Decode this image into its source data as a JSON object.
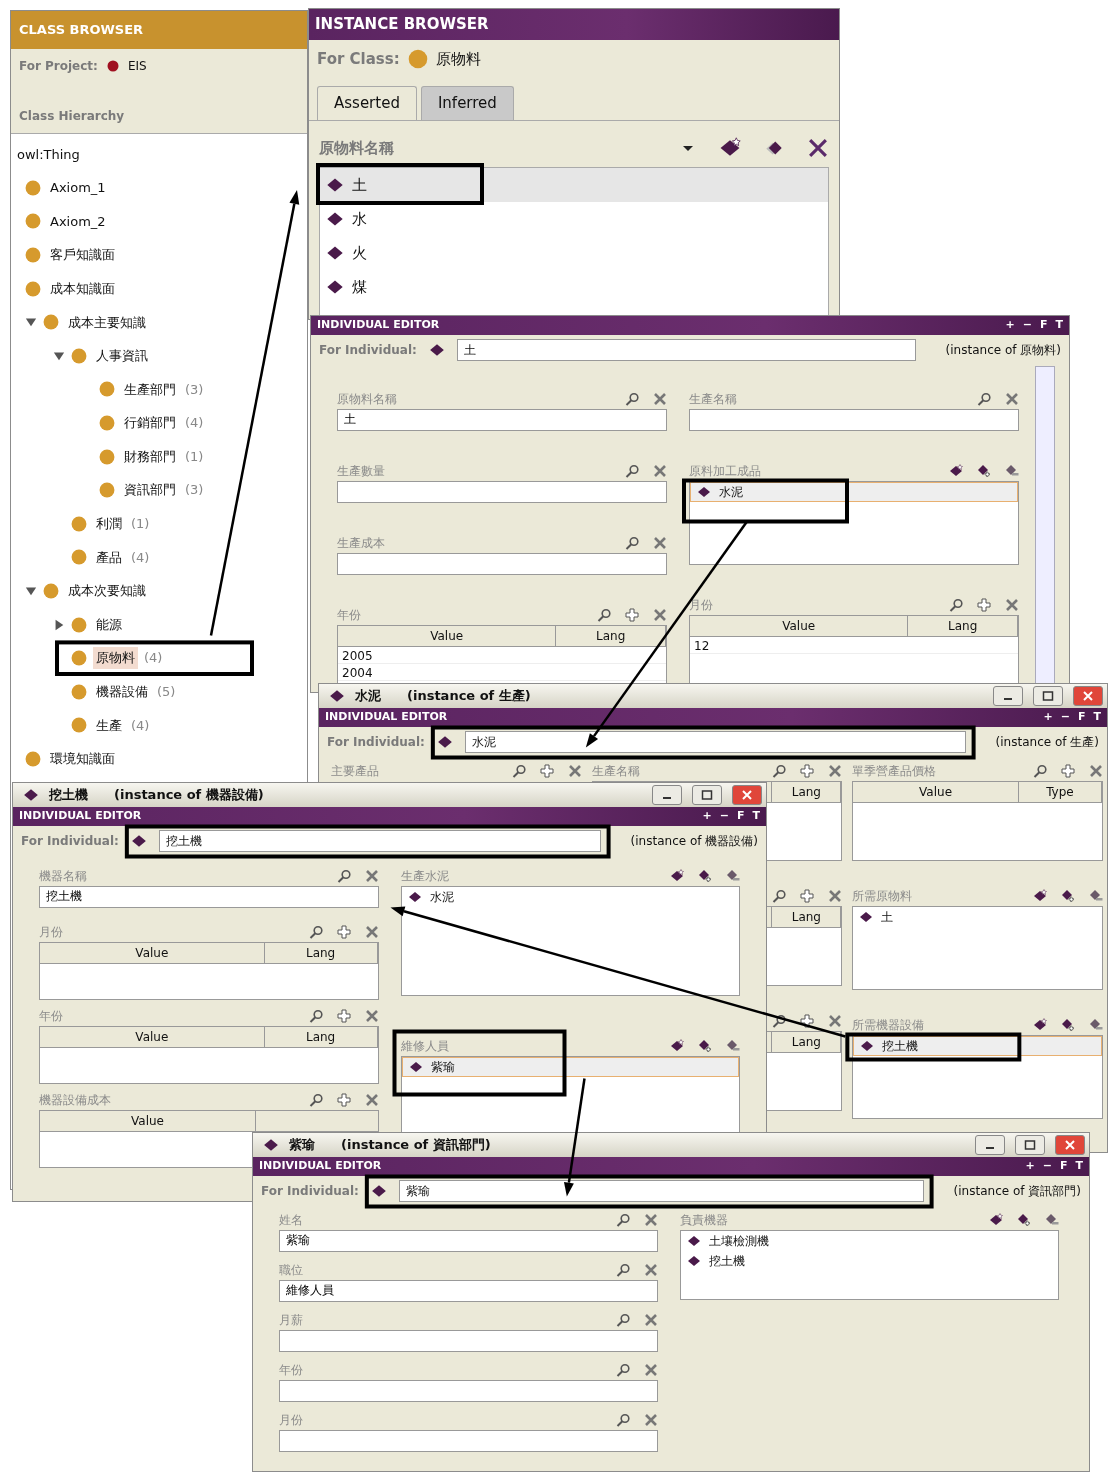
{
  "class_browser": {
    "title": "CLASS BROWSER",
    "project_label": "For Project:",
    "project": "EIS",
    "hierarchy_label": "Class Hierarchy",
    "root": "owl:Thing",
    "classes": [
      {
        "name": "Axiom_1",
        "selected": false
      },
      {
        "name": "Axiom_2",
        "selected": false
      },
      {
        "name": "客戶知識面",
        "selected": false
      },
      {
        "name": "成本知識面",
        "selected": false
      },
      {
        "name": "成本主要知識",
        "selected": false,
        "expanded": true,
        "children": [
          {
            "name": "人事資訊",
            "selected": false,
            "expanded": true,
            "children": [
              {
                "name": "生產部門",
                "count": "(3)",
                "selected": false
              },
              {
                "name": "行銷部門",
                "count": "(4)",
                "selected": false
              },
              {
                "name": "財務部門",
                "count": "(1)",
                "selected": false
              },
              {
                "name": "資訊部門",
                "count": "(3)",
                "selected": false
              }
            ]
          },
          {
            "name": "利潤",
            "count": "(1)",
            "selected": false
          },
          {
            "name": "產品",
            "count": "(4)",
            "selected": false
          }
        ]
      },
      {
        "name": "成本次要知識",
        "selected": false,
        "expanded": true,
        "children": [
          {
            "name": "能源",
            "selected": false,
            "expanded": false
          },
          {
            "name": "原物料",
            "count": "(4)",
            "selected": true
          },
          {
            "name": "機器設備",
            "count": "(5)",
            "selected": false
          },
          {
            "name": "生產",
            "count": "(4)",
            "selected": false
          }
        ]
      },
      {
        "name": "環境知識面",
        "selected": false
      }
    ]
  },
  "instance_browser": {
    "title": "INSTANCE BROWSER",
    "class_label": "For Class:",
    "class_name": "原物料",
    "tabs": [
      {
        "label": "Asserted",
        "selected": true
      },
      {
        "label": "Inferred",
        "selected": false
      }
    ],
    "list_header": "原物料名稱",
    "instances": [
      {
        "name": "土",
        "selected": true
      },
      {
        "name": "水",
        "selected": false
      },
      {
        "name": "火",
        "selected": false
      },
      {
        "name": "煤",
        "selected": false
      }
    ]
  },
  "editors": [
    {
      "title": "INDIVIDUAL EDITOR",
      "bar_buttons": [
        "+",
        "−",
        "F",
        "T"
      ],
      "for_label": "For Individual:",
      "individual": "土",
      "instance_of": "(instance of 原物料)",
      "columns": [
        [
          {
            "kind": "text",
            "label": "原物料名稱",
            "value": "土"
          },
          {
            "kind": "text",
            "label": "生產數量"
          },
          {
            "kind": "text",
            "label": "生產成本"
          },
          {
            "kind": "table",
            "label": "年份",
            "headers": [
              "Value",
              "Lang"
            ],
            "rows": [
              {
                "value": "2005"
              },
              {
                "value": "2004"
              }
            ]
          }
        ],
        [
          {
            "kind": "text",
            "label": "生產名稱"
          },
          {
            "kind": "list",
            "label": "原料加工成品",
            "items": [
              {
                "name": "水泥",
                "selected": true
              }
            ]
          },
          {
            "kind": "table",
            "label": "月份",
            "headers": [
              "Value",
              "Lang"
            ],
            "rows": [
              {
                "value": "12"
              }
            ]
          }
        ]
      ]
    },
    {
      "window_title": {
        "name": "水泥",
        "instance_of": "(instance of 生產)"
      },
      "title": "INDIVIDUAL EDITOR",
      "bar_buttons": [
        "+",
        "−",
        "F",
        "T"
      ],
      "for_label": "For Individual:",
      "individual": "水泥",
      "instance_of": "(instance of 生產)",
      "columns": [
        [
          {
            "kind": "table",
            "label": "主要產品"
          }
        ],
        [
          {
            "kind": "table",
            "label": "生產名稱",
            "headers": [
              "Lang"
            ]
          },
          {
            "kind": "table",
            "headers": [
              "Lang"
            ]
          },
          {
            "kind": "table",
            "headers": [
              "Lang"
            ]
          }
        ],
        [
          {
            "kind": "table",
            "label": "單季營產品價格",
            "headers": [
              "Value",
              "Type"
            ]
          },
          {
            "kind": "list",
            "label": "所需原物料",
            "items": [
              {
                "name": "土",
                "selected": false
              }
            ]
          },
          {
            "kind": "list",
            "label": "所需機器設備",
            "items": [
              {
                "name": "挖土機",
                "selected": true
              }
            ]
          }
        ]
      ]
    },
    {
      "window_title": {
        "name": "挖土機",
        "instance_of": "(instance of 機器設備)"
      },
      "title": "INDIVIDUAL EDITOR",
      "bar_buttons": [
        "+",
        "−",
        "F",
        "T"
      ],
      "for_label": "For Individual:",
      "individual": "挖土機",
      "instance_of": "(instance of 機器設備)",
      "columns": [
        [
          {
            "kind": "text",
            "label": "機器名稱",
            "value": "挖土機"
          },
          {
            "kind": "table",
            "label": "月份",
            "headers": [
              "Value",
              "Lang"
            ]
          },
          {
            "kind": "table",
            "label": "年份",
            "headers": [
              "Value",
              "Lang"
            ]
          },
          {
            "kind": "table",
            "label": "機器設備成本",
            "headers": [
              "Value"
            ]
          }
        ],
        [
          {
            "kind": "list",
            "label": "生產水泥",
            "items": [
              {
                "name": "水泥",
                "selected": false
              }
            ]
          },
          {
            "kind": "list",
            "label": "維修人員",
            "items": [
              {
                "name": "紫瑜",
                "selected": true
              }
            ]
          }
        ]
      ]
    },
    {
      "window_title": {
        "name": "紫瑜",
        "instance_of": "(instance of 資訊部門)"
      },
      "title": "INDIVIDUAL EDITOR",
      "bar_buttons": [
        "+",
        "−",
        "F",
        "T"
      ],
      "for_label": "For Individual:",
      "individual": "紫瑜",
      "instance_of": "(instance of 資訊部門)",
      "columns": [
        [
          {
            "kind": "text",
            "label": "姓名",
            "value": "紫瑜"
          },
          {
            "kind": "text",
            "label": "職位",
            "value": "維修人員"
          },
          {
            "kind": "text",
            "label": "月薪"
          },
          {
            "kind": "text",
            "label": "年份"
          },
          {
            "kind": "text",
            "label": "月份"
          }
        ],
        [
          {
            "kind": "list",
            "label": "負責機器",
            "items": [
              {
                "name": "土壤檢測機",
                "selected": false
              },
              {
                "name": "挖土機",
                "selected": false
              }
            ]
          }
        ]
      ]
    }
  ]
}
